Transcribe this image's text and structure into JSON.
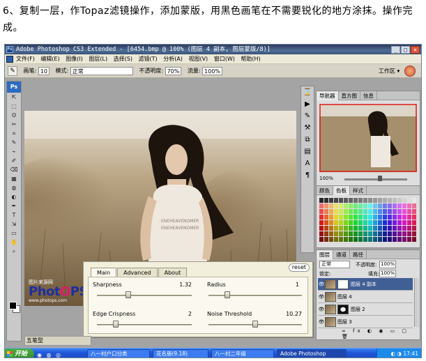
{
  "caption": "6、复制一层，作Topaz滤镜操作，添加蒙版，用黑色画笔在不需要锐化的地方涂抹。操作完成。",
  "window": {
    "title": "Adobe Photoshop CS3 Extended - [6454.bmp @ 100% (图层 4 副本, 图层蒙版/8)]",
    "controls": [
      "_",
      "□",
      "×"
    ]
  },
  "menu": [
    "文件(F)",
    "编辑(E)",
    "图像(I)",
    "图层(L)",
    "选择(S)",
    "滤镜(T)",
    "分析(A)",
    "视图(V)",
    "窗口(W)",
    "帮助(H)"
  ],
  "options": {
    "brush_label": "画笔:",
    "brush_size": "10",
    "mode_label": "模式:",
    "mode_value": "正常",
    "opacity_label": "不透明度:",
    "opacity_value": "70%",
    "flow_label": "流量:",
    "flow_value": "100%",
    "workspace_label": "工作区 ▾"
  },
  "tools": [
    "⇱",
    "⬚",
    "ʘ",
    "✂",
    "⌗",
    "✎",
    "⌁",
    "✐",
    "⌫",
    "▦",
    "◍",
    "◐",
    "✒",
    "T",
    "⇲",
    "▭",
    "✋",
    "⌕"
  ],
  "watermark": {
    "top": "图片来源网",
    "big_pre": "Phot",
    "big_o": "O",
    "big_post": "PS",
    "url": "www.photops.com"
  },
  "navigator": {
    "tabs": [
      "导航器",
      "直方图",
      "信息"
    ],
    "zoom": "100%"
  },
  "color_panel": {
    "tabs": [
      "颜色",
      "色板",
      "样式"
    ]
  },
  "layers": {
    "tabs": [
      "图层",
      "通道",
      "路径"
    ],
    "blend_mode": "正常",
    "opacity_label": "不透明度:",
    "opacity_value": "100%",
    "lock_label": "锁定:",
    "fill_label": "填充:",
    "fill_value": "100%",
    "rows": [
      {
        "name": "图层 4 副本",
        "selected": true,
        "mask": "white"
      },
      {
        "name": "图层 4",
        "selected": false,
        "mask": "none"
      },
      {
        "name": "图层 2",
        "selected": false,
        "mask": "dark"
      },
      {
        "name": "图层 3",
        "selected": false,
        "mask": "none"
      }
    ]
  },
  "dialog": {
    "tabs": [
      "Main",
      "Advanced",
      "About"
    ],
    "reset_label": "reset",
    "params": [
      {
        "label": "Sharpness",
        "value": "1.32",
        "level": 0.33
      },
      {
        "label": "Radius",
        "value": "1",
        "level": 0.2
      },
      {
        "label": "Edge Crispness",
        "value": "2",
        "level": 0.2
      },
      {
        "label": "Noise Threshold",
        "value": "10.27",
        "level": 0.5
      }
    ]
  },
  "doc_status": "五笔型",
  "taskbar": {
    "start": "开始",
    "items": [
      "八一村户口分类",
      "花名册(9.18)",
      "八一村二年级",
      "Adobe Photoshop"
    ],
    "clock": "17:41"
  },
  "colors": {
    "title_bg": "#3b5478",
    "selected_layer": "#3f5f95",
    "taskbar": "#2157d8",
    "start": "#2e8b2a"
  }
}
